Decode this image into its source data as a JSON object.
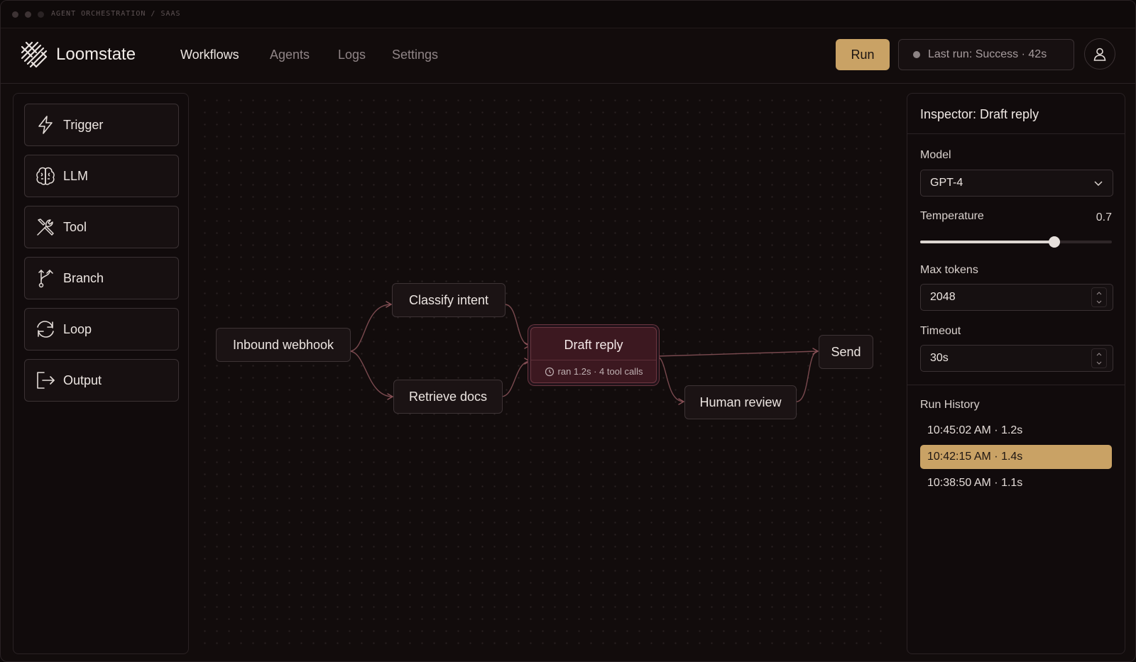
{
  "window": {
    "title": "AGENT ORCHESTRATION / SAAS"
  },
  "header": {
    "brand": "Loomstate",
    "nav": [
      "Workflows",
      "Agents",
      "Logs",
      "Settings"
    ],
    "active_nav": "Workflows",
    "run_label": "Run",
    "last_run": "Last run: Success · 42s"
  },
  "palette": {
    "items": [
      {
        "label": "Trigger",
        "icon": "lightning-icon"
      },
      {
        "label": "LLM",
        "icon": "brain-icon"
      },
      {
        "label": "Tool",
        "icon": "tools-icon"
      },
      {
        "label": "Branch",
        "icon": "branch-icon"
      },
      {
        "label": "Loop",
        "icon": "loop-icon"
      },
      {
        "label": "Output",
        "icon": "output-icon"
      }
    ]
  },
  "canvas": {
    "nodes": {
      "inbound": "Inbound webhook",
      "classify": "Classify intent",
      "retrieve": "Retrieve docs",
      "draft": "Draft reply",
      "draft_meta": "ran 1.2s · 4 tool calls",
      "review": "Human review",
      "send": "Send"
    },
    "selected_node": "Draft reply"
  },
  "inspector": {
    "title": "Inspector: Draft reply",
    "model_label": "Model",
    "model_value": "GPT-4",
    "temperature_label": "Temperature",
    "temperature_value": "0.7",
    "temperature_fraction": 0.7,
    "max_tokens_label": "Max tokens",
    "max_tokens_value": "2048",
    "timeout_label": "Timeout",
    "timeout_value": "30s",
    "history_label": "Run History",
    "history": [
      "10:45:02 AM · 1.2s",
      "10:42:15 AM · 1.4s",
      "10:38:50 AM · 1.1s"
    ],
    "history_selected": 1
  },
  "colors": {
    "accent": "#c9a265",
    "background": "#120c0c",
    "selected_node": "#3c1820",
    "edge": "#7a4a4f"
  }
}
